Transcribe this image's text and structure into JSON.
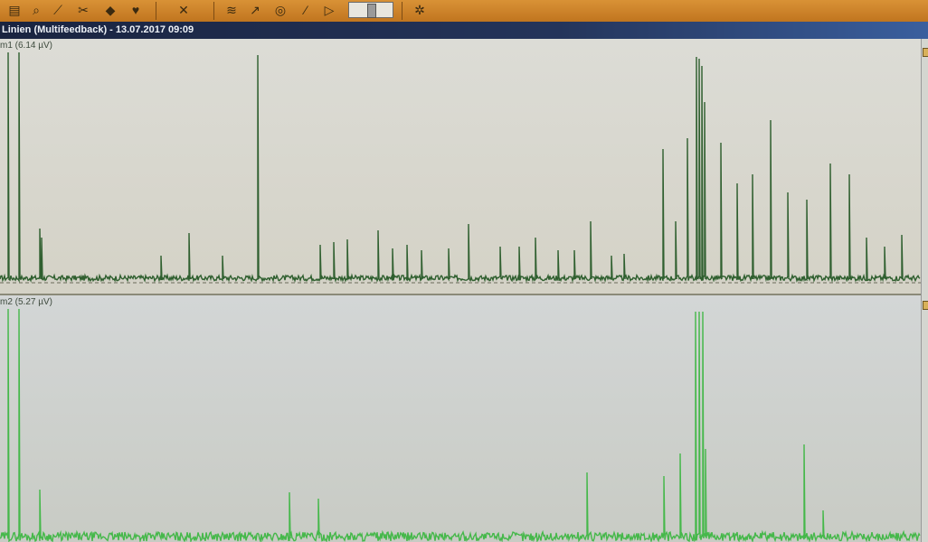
{
  "toolbar": {
    "icons": [
      "folder-icon",
      "search-icon",
      "pin-icon",
      "scissors-icon",
      "tag-icon",
      "heart-icon",
      "tools-icon",
      "layers-icon",
      "graph-icon",
      "globe-icon",
      "wand-icon",
      "play-icon",
      "slider-icon",
      "settings-icon"
    ]
  },
  "window": {
    "title": "Linien (Multifeedback)  -  13.07.2017  09:09"
  },
  "channels": [
    {
      "label": "m1  (6.14 µV)",
      "color": "#2f5f2f"
    },
    {
      "label": "m2  (5.27 µV)",
      "color": "#45b84a"
    }
  ]
}
